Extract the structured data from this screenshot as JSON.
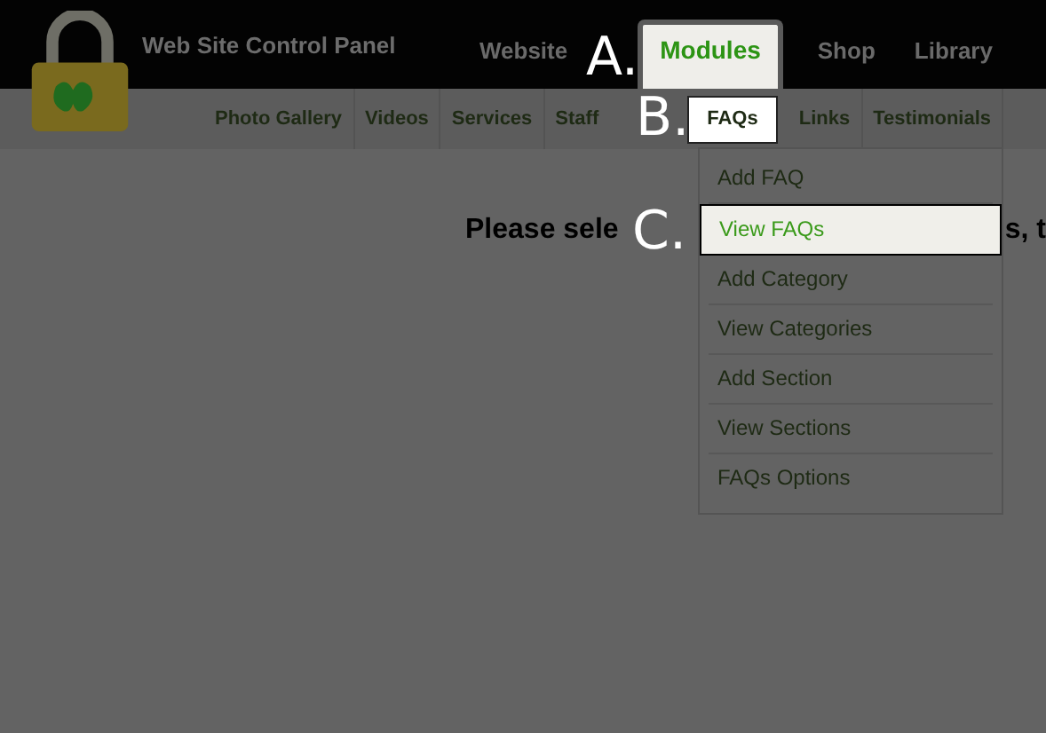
{
  "header": {
    "title": "Web Site Control Panel",
    "tabs": [
      {
        "label": "Website",
        "selected": false
      },
      {
        "label": "Modules",
        "selected": true
      },
      {
        "label": "Shop",
        "selected": false
      },
      {
        "label": "Library",
        "selected": false
      }
    ]
  },
  "subnav": {
    "items": [
      {
        "label": "Photo Gallery",
        "selected": false
      },
      {
        "label": "Videos",
        "selected": false
      },
      {
        "label": "Services",
        "selected": false
      },
      {
        "label": "Staff",
        "selected": false
      },
      {
        "label": "FAQs",
        "selected": true
      },
      {
        "label": "Links",
        "selected": false
      },
      {
        "label": "Testimonials",
        "selected": false
      }
    ]
  },
  "dropdown": {
    "items": [
      {
        "label": "Add FAQ",
        "selected": false
      },
      {
        "label": "View FAQs",
        "selected": true
      },
      {
        "label": "Add Category",
        "selected": false
      },
      {
        "label": "View Categories",
        "selected": false
      },
      {
        "label": "Add Section",
        "selected": false
      },
      {
        "label": "View Sections",
        "selected": false
      },
      {
        "label": "FAQs Options",
        "selected": false
      }
    ]
  },
  "heading": {
    "visible_start": "Please sele",
    "visible_end": "s, t"
  },
  "annotations": [
    "A.",
    "B.",
    "C."
  ]
}
